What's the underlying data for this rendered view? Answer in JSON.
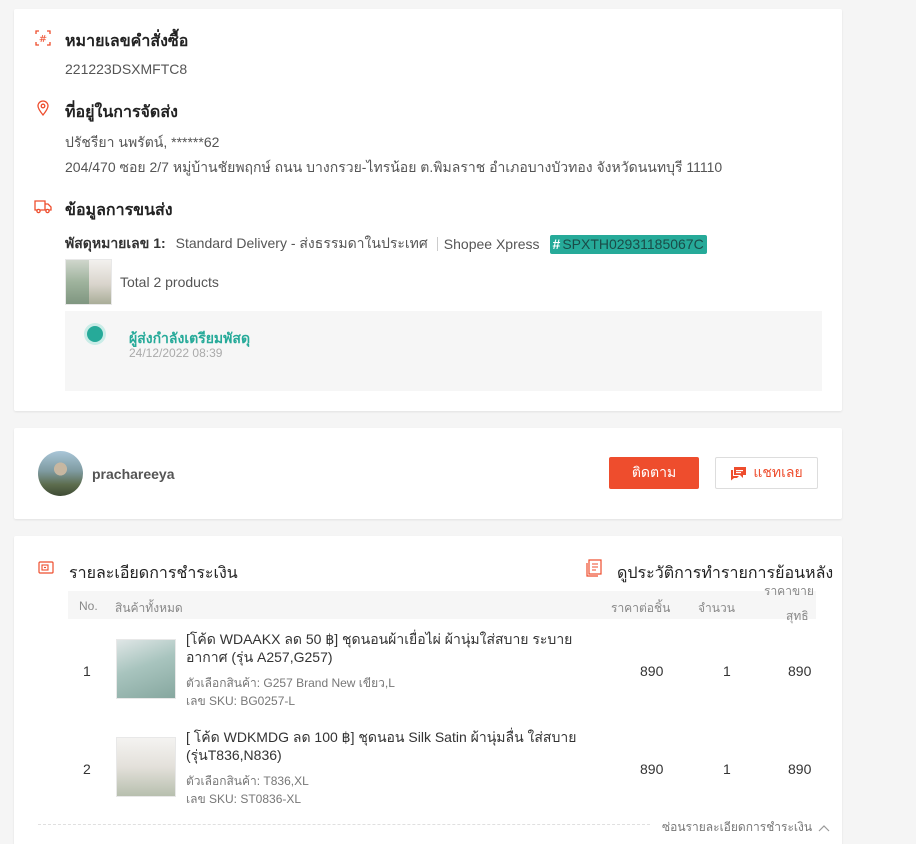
{
  "order": {
    "order_no_title": "หมายเลขคำสั่งซื้อ",
    "order_no": "221223DSXMFTC8",
    "address_title": "ที่อยู่ในการจัดส่ง",
    "recipient": "ปรัชรียา นพรัตน์, ******62",
    "address": "204/470 ซอย 2/7 หมู่บ้านชัยพฤกษ์ ถนน บางกรวย-ไทรน้อย ต.พิมลราช อำเภอบางบัวทอง จังหวัดนนทบุรี 11110",
    "shipping_title": "ข้อมูลการขนส่ง",
    "parcel_label": "พัสดุหมายเลข 1:",
    "parcel_service": "Standard Delivery - ส่งธรรมดาในประเทศ",
    "parcel_carrier": "Shopee Xpress",
    "tracking_hash": "#",
    "tracking_code": "SPXTH02931185067C",
    "total_products": "Total 2 products",
    "status_text": "ผู้ส่งกำลังเตรียมพัสดุ",
    "status_time": "24/12/2022 08:39"
  },
  "seller": {
    "name": "prachareeya",
    "follow_label": "ติดตาม",
    "chat_label": "แชทเลย"
  },
  "payment": {
    "title": "รายละเอียดการชำระเงิน",
    "history_title": "ดูประวัติการทำรายการย้อนหลัง",
    "headers": {
      "no": "No.",
      "product": "สินค้าทั้งหมด",
      "unit_price": "ราคาต่อชิ้น",
      "qty": "จำนวน",
      "net_line1": "ราคาขาย",
      "net_line2": "สุทธิ"
    },
    "rows": [
      {
        "no": "1",
        "name": "[โค้ด WDAAKX ลด 50 ฿] ชุดนอนผ้าเยื่อไผ่ ผ้านุ่มใส่สบาย ระบายอากาศ (รุ่น A257,G257)",
        "option": "ตัวเลือกสินค้า: G257 Brand New เขียว,L",
        "sku": "เลข SKU: BG0257-L",
        "price": "890",
        "qty": "1",
        "net": "890"
      },
      {
        "no": "2",
        "name": "[ โค้ด WDKMDG ลด 100 ฿] ชุดนอน Silk Satin ผ้านุ่มลื่น ใส่สบาย (รุ่นT836,N836)",
        "option": "ตัวเลือกสินค้า: T836,XL",
        "sku": "เลข SKU: ST0836-XL",
        "price": "890",
        "qty": "1",
        "net": "890"
      }
    ],
    "hide_label": "ซ่อนรายละเอียดการชำระเงิน"
  },
  "colors": {
    "accent": "#ee4d2d",
    "teal": "#26aa99",
    "icon_red": "#ee4d2d"
  }
}
